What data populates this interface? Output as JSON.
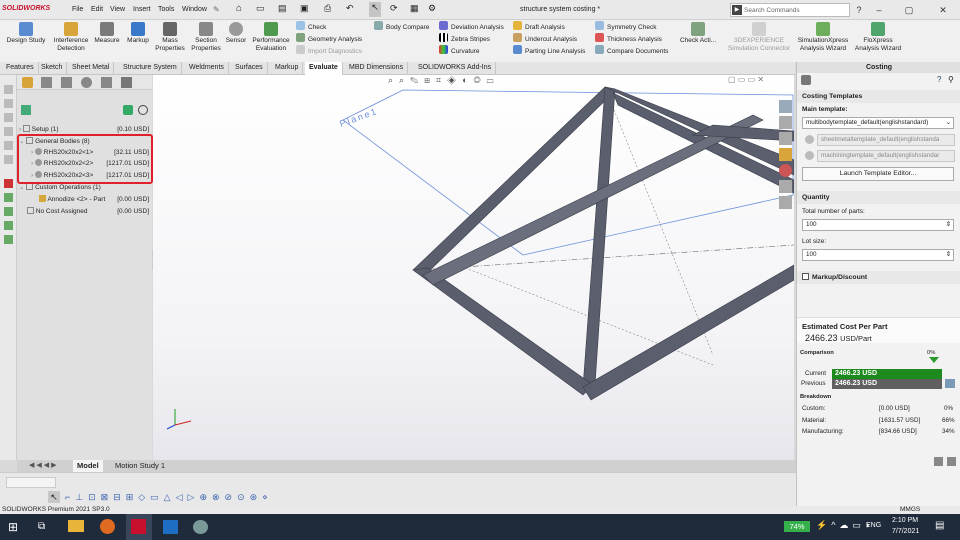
{
  "app": {
    "logo": "SOLIDWORKS",
    "document_title": "structure system costing *",
    "menu": [
      "File",
      "Edit",
      "View",
      "Insert",
      "Tools",
      "Window"
    ],
    "search_placeholder": "Search Commands"
  },
  "ribbon": {
    "big_tools": [
      "Design Study",
      "Interference Detection",
      "Measure",
      "Markup",
      "Mass Properties",
      "Section Properties",
      "Sensor",
      "Performance Evaluation"
    ],
    "col1": [
      "Check",
      "Geometry Analysis",
      "Import Diagnostics"
    ],
    "col2": [
      "Body Compare"
    ],
    "col3": [
      "Deviation Analysis",
      "Zebra Stripes",
      "Curvature"
    ],
    "col4": [
      "Draft Analysis",
      "Undercut Analysis",
      "Parting Line Analysis"
    ],
    "col5": [
      "Symmetry Check",
      "Thickness Analysis",
      "Compare Documents"
    ],
    "check_active": "Check Acti...",
    "right_tools": [
      "3DEXPERIENCE Simulation Connector",
      "SimulationXpress Analysis Wizard",
      "FloXpress Analysis Wizard"
    ]
  },
  "tabs": [
    "Features",
    "Sketch",
    "Sheet Metal",
    "Structure System",
    "Weldments",
    "Surfaces",
    "Markup",
    "Evaluate",
    "MBD Dimensions",
    "SOLIDWORKS Add-Ins"
  ],
  "active_tab": "Evaluate",
  "tree": [
    {
      "label": "Setup (1)",
      "value": "[0.10 USD]"
    },
    {
      "label": "General Bodies (8)",
      "value": ""
    },
    {
      "label": "RHS20x20x2<1>",
      "value": "[32.11 USD]"
    },
    {
      "label": "RHS20x20x2<2>",
      "value": "[1217.01 USD]"
    },
    {
      "label": "RHS20x20x2<3>",
      "value": "[1217.01 USD]"
    },
    {
      "label": "Custom Operations (1)",
      "value": ""
    },
    {
      "label": "Annodize <2> - Part",
      "value": "[0.00 USD]"
    },
    {
      "label": "No Cost Assigned",
      "value": "[0.00 USD]"
    }
  ],
  "viewport": {
    "plane_label": "Plane1"
  },
  "costing": {
    "title": "Costing",
    "templates_header": "Costing Templates",
    "main_template_label": "Main template:",
    "main_template": "multibodytemplate_default(englishstandard)",
    "sheetmetal_template": "sheetmetaltemplate_default(englishstanda",
    "machining_template": "machiningtemplate_default(englishstandar",
    "launch_button": "Launch Template Editor...",
    "quantity_header": "Quantity",
    "total_parts_label": "Total number of parts:",
    "total_parts": "100",
    "lot_size_label": "Lot size:",
    "lot_size": "100",
    "markup_header": "Markup/Discount",
    "estimated_header": "Estimated Cost Per Part",
    "estimated_value": "2466.23",
    "estimated_unit": "USD/Part",
    "comparison_label": "Comparison",
    "comparison_pct": "0%",
    "current_label": "Current",
    "current_value": "2466.23 USD",
    "previous_label": "Previous",
    "previous_value": "2466.23 USD",
    "breakdown_label": "Breakdown",
    "breakdown": [
      {
        "name": "Custom:",
        "value": "[0.00 USD]",
        "pct": "0%"
      },
      {
        "name": "Material:",
        "value": "[1631.57 USD]",
        "pct": "66%"
      },
      {
        "name": "Manufacturing:",
        "value": "[834.66 USD]",
        "pct": "34%"
      }
    ]
  },
  "bottom_tabs": [
    "Model",
    "Motion Study 1"
  ],
  "status": {
    "left": "SOLIDWORKS Premium 2021 SP3.0",
    "units": "MMGS"
  },
  "taskbar": {
    "battery": "74%",
    "lang": "ENG",
    "time": "2:10 PM",
    "date": "7/7/2021"
  },
  "colors": {
    "accent_red": "#e0202a",
    "current_green": "#1c8a1c",
    "previous_gray": "#606060"
  }
}
